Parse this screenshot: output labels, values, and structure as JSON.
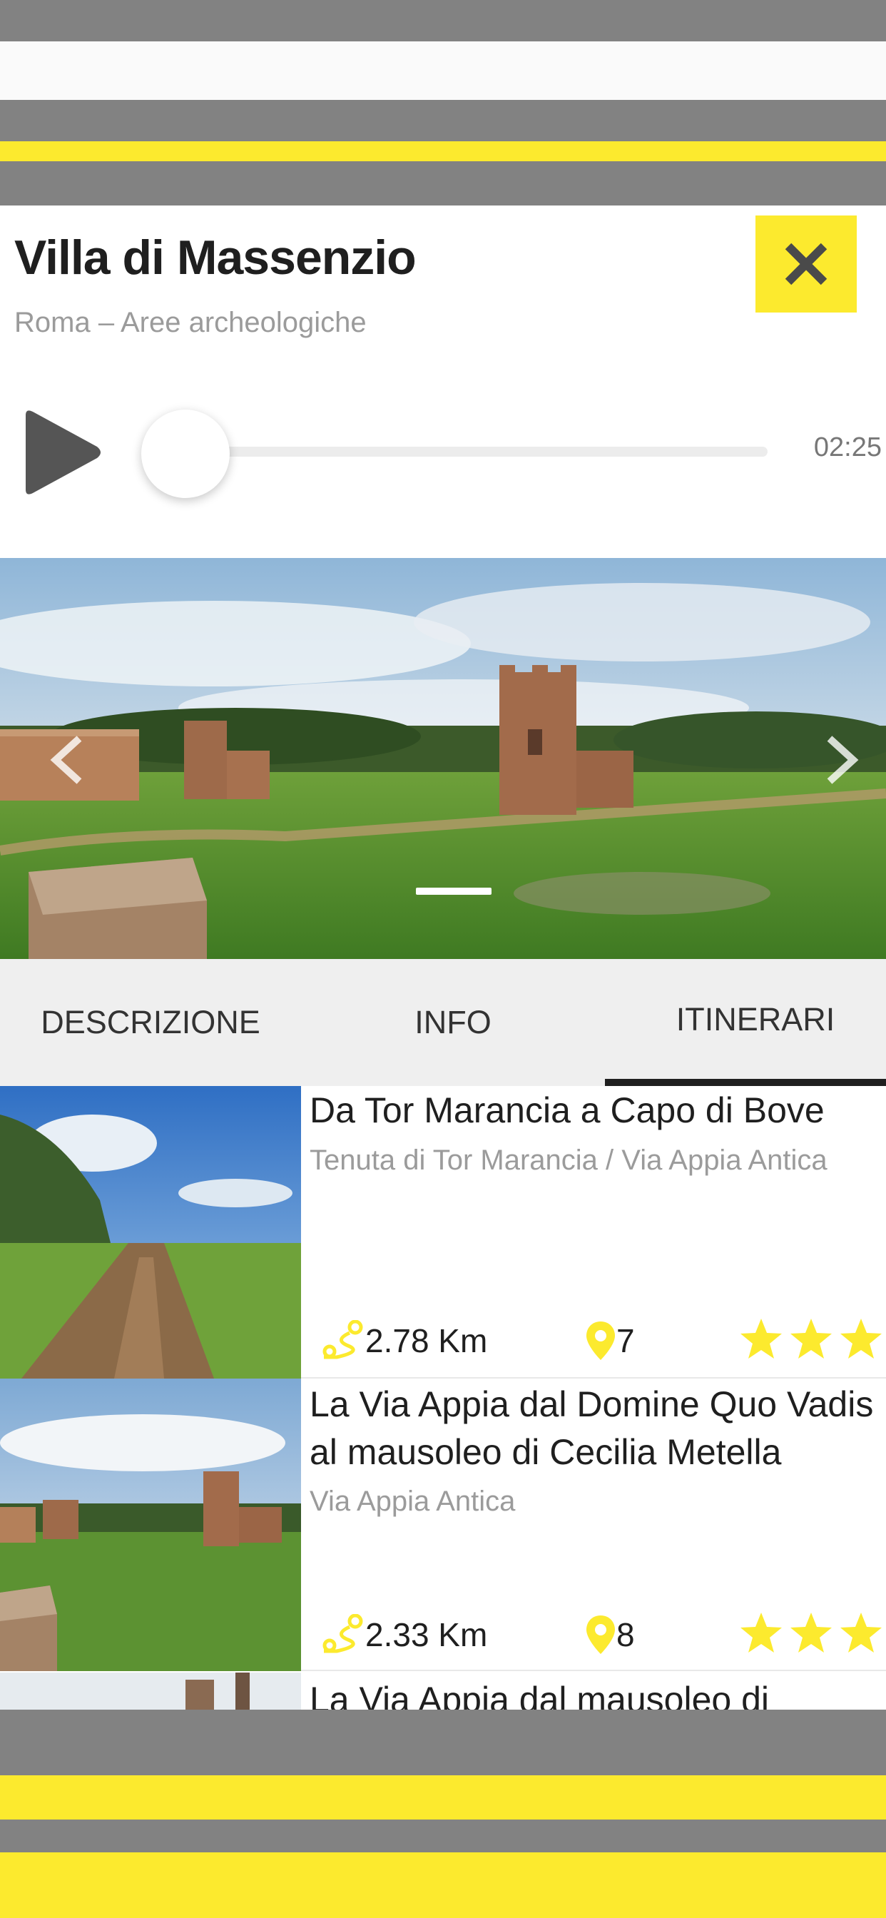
{
  "header": {
    "title": "Villa di Massenzio",
    "subtitle": "Roma – Aree archeologiche",
    "close_icon": "close-icon"
  },
  "player": {
    "play_icon": "play-icon",
    "progress": 0.0,
    "duration": "02:25"
  },
  "gallery": {
    "prev_icon": "chevron-left-icon",
    "next_icon": "chevron-right-icon"
  },
  "tabs": [
    {
      "label": "DESCRIZIONE",
      "active": false
    },
    {
      "label": "INFO",
      "active": false
    },
    {
      "label": "ITINERARI",
      "active": true
    }
  ],
  "itineraries": [
    {
      "title_lines": [
        "Da Tor Marancia a Capo di Bove"
      ],
      "subtitle": "Tenuta di Tor Marancia / Via Appia Antica",
      "distance": "2.78 Km",
      "stops": "7",
      "rating": 3
    },
    {
      "title_lines": [
        "La Via Appia dal Domine Quo Vadis",
        "al mausoleo di Cecilia Metella"
      ],
      "subtitle": "Via Appia Antica",
      "distance": "2.33 Km",
      "stops": "8",
      "rating": 3
    },
    {
      "title_lines": [
        "La Via Appia dal mausoleo di"
      ],
      "subtitle": "",
      "distance": "",
      "stops": "",
      "rating": 0
    }
  ],
  "colors": {
    "accent_yellow": "#fcea2e",
    "bar_grey": "#828282",
    "text_dark": "#1f1f1f",
    "text_muted": "#9b9b9b"
  }
}
